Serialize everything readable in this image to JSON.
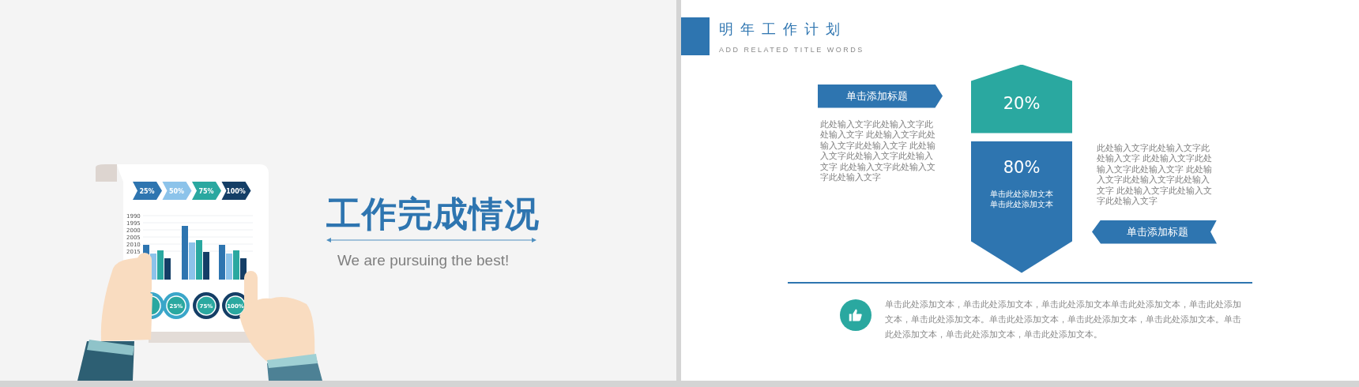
{
  "left_slide": {
    "illustration": {
      "chevrons": [
        "25%",
        "50%",
        "75%",
        "100%"
      ],
      "year_ticks": [
        "1990",
        "1995",
        "2000",
        "2005",
        "2010",
        "2015"
      ],
      "dial_labels": [
        "25%",
        "75%",
        "100%"
      ]
    },
    "title": "工作完成情况",
    "subtitle": "We are pursuing the best!"
  },
  "right_slide": {
    "title": "明年工作计划",
    "subtitle": "ADD RELATED TITLE WORDS",
    "left_banner": "单击添加标题",
    "left_text": "此处输入文字此处输入文字此处输入文字 此处输入文字此处输入文字此处输入文字 此处输入文字此处输入文字此处输入文字 此处输入文字此处输入文字此处输入文字",
    "top_shape": {
      "value": "20%"
    },
    "bottom_shape": {
      "value": "80%",
      "lines": [
        "单击此处添加文本",
        "单击此处添加文本"
      ]
    },
    "right_text": "此处输入文字此处输入文字此处输入文字 此处输入文字此处输入文字此处输入文字 此处输入文字此处输入文字此处输入文字 此处输入文字此处输入文字此处输入文字",
    "right_banner": "单击添加标题",
    "note": "单击此处添加文本，单击此处添加文本，单击此处添加文本单击此处添加文本，单击此处添加文本，单击此处添加文本。单击此处添加文本，单击此处添加文本，单击此处添加文本。单击此处添加文本，单击此处添加文本，单击此处添加文本。"
  }
}
